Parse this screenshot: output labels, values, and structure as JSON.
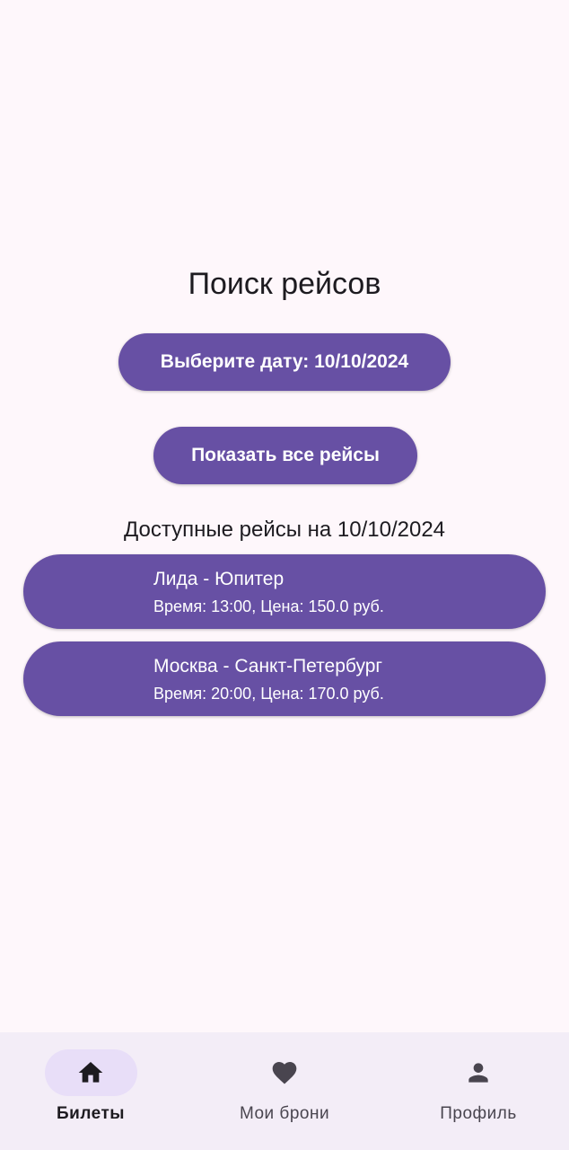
{
  "search": {
    "title": "Поиск рейсов",
    "date_button_label": "Выберите дату: 10/10/2024",
    "show_all_label": "Показать все рейсы",
    "available_title": "Доступные рейсы на 10/10/2024"
  },
  "flights": [
    {
      "route": "Лида - Юпитер",
      "info": "Время: 13:00, Цена: 150.0 руб."
    },
    {
      "route": "Москва - Санкт-Петербург",
      "info": "Время: 20:00, Цена: 170.0 руб."
    }
  ],
  "bottom_nav": {
    "items": [
      {
        "label": "Билеты",
        "icon": "home-icon",
        "selected": true
      },
      {
        "label": "Мои брони",
        "icon": "heart-icon",
        "selected": false
      },
      {
        "label": "Профиль",
        "icon": "person-icon",
        "selected": false
      }
    ]
  },
  "colors": {
    "primary": "#6750a4",
    "background": "#fef7fb",
    "nav_background": "#f3edf7",
    "nav_indicator": "#e8def8"
  }
}
